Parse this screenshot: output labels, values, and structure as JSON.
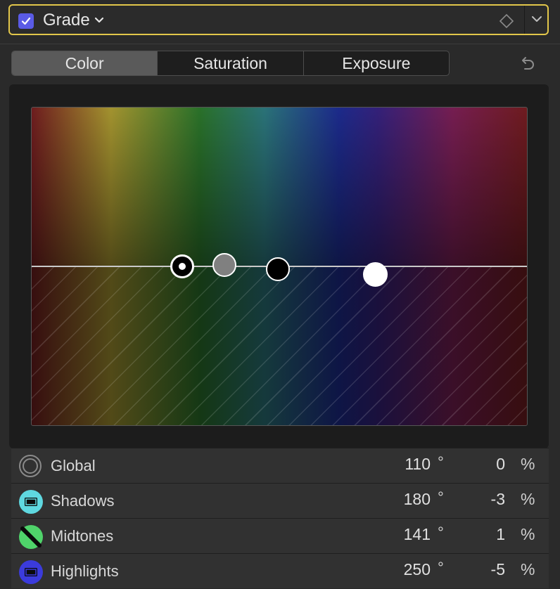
{
  "header": {
    "title": "Grade",
    "checked": true,
    "accent_color": "#5a5be6",
    "border_color": "#e2c64a",
    "icons": [
      "checkmark-icon",
      "chevron-down-icon",
      "keyframe-diamond-icon",
      "menu-chevron-icon"
    ]
  },
  "tabs": [
    {
      "label": "Color",
      "active": true
    },
    {
      "label": "Saturation",
      "active": false
    },
    {
      "label": "Exposure",
      "active": false
    }
  ],
  "toolbar": {
    "reset_icon": "undo-icon"
  },
  "color_board": {
    "pucks": [
      {
        "name": "Global",
        "style": "black-with-white-dot"
      },
      {
        "name": "Midtones",
        "style": "gray"
      },
      {
        "name": "Shadows",
        "style": "black"
      },
      {
        "name": "Highlights",
        "style": "white"
      }
    ]
  },
  "rows": [
    {
      "label": "Global",
      "hue": "110",
      "hue_unit": "°",
      "amount": "0",
      "amount_unit": "%",
      "icon": "global-ring-icon"
    },
    {
      "label": "Shadows",
      "hue": "180",
      "hue_unit": "°",
      "amount": "-3",
      "amount_unit": "%",
      "icon": "shadows-icon",
      "icon_color": "#5fd8e0"
    },
    {
      "label": "Midtones",
      "hue": "141",
      "hue_unit": "°",
      "amount": "1",
      "amount_unit": "%",
      "icon": "midtones-icon",
      "icon_color": "#4fd36a"
    },
    {
      "label": "Highlights",
      "hue": "250",
      "hue_unit": "°",
      "amount": "-5",
      "amount_unit": "%",
      "icon": "highlights-icon",
      "icon_color": "#3b3bdc"
    }
  ]
}
